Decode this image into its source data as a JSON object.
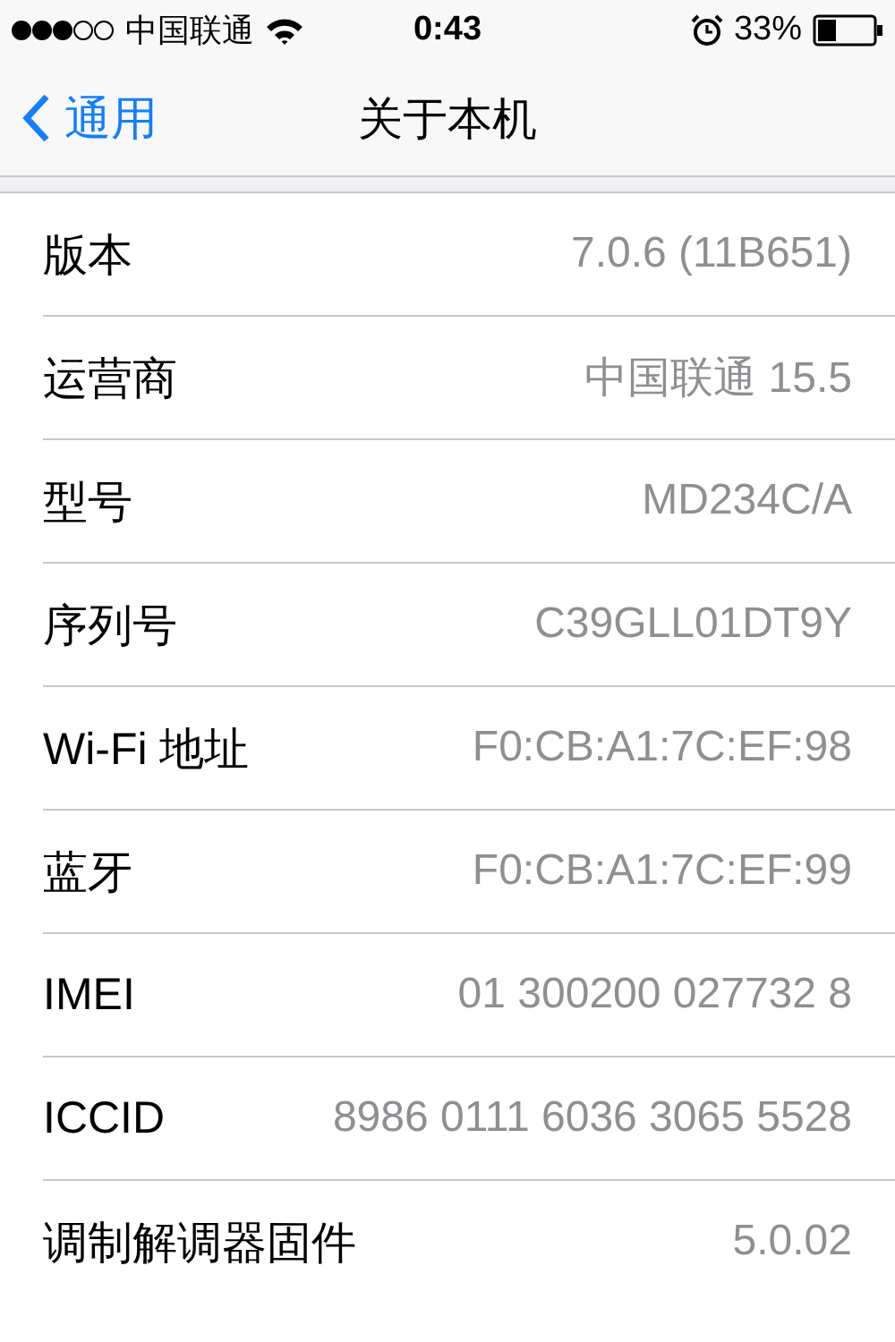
{
  "status_bar": {
    "carrier": "中国联通",
    "time": "0:43",
    "battery": "33%"
  },
  "nav": {
    "back": "通用",
    "title": "关于本机"
  },
  "rows": [
    {
      "label": "版本",
      "value": "7.0.6 (11B651)"
    },
    {
      "label": "运营商",
      "value": "中国联通 15.5"
    },
    {
      "label": "型号",
      "value": "MD234C/A"
    },
    {
      "label": "序列号",
      "value": "C39GLL01DT9Y"
    },
    {
      "label": "Wi-Fi 地址",
      "value": "F0:CB:A1:7C:EF:98"
    },
    {
      "label": "蓝牙",
      "value": "F0:CB:A1:7C:EF:99"
    },
    {
      "label": "IMEI",
      "value": "01 300200 027732 8"
    },
    {
      "label": "ICCID",
      "value": "8986 0111 6036 3065 5528"
    },
    {
      "label": "调制解调器固件",
      "value": "5.0.02"
    }
  ]
}
